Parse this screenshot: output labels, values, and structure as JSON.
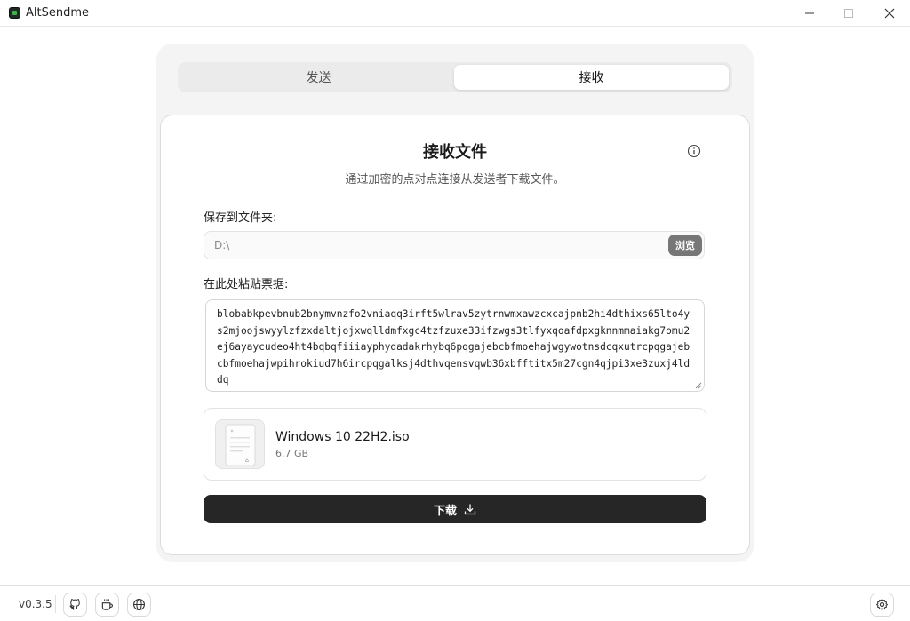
{
  "window": {
    "title": "AltSendme",
    "controls": {
      "minimize": "minimize-icon",
      "maximize": "maximize-icon",
      "close": "close-icon"
    }
  },
  "tabs": [
    {
      "label": "发送",
      "active": false
    },
    {
      "label": "接收",
      "active": true
    }
  ],
  "receive": {
    "title": "接收文件",
    "subtitle": "通过加密的点对点连接从发送者下载文件。",
    "folder_label": "保存到文件夹:",
    "folder_value": "D:\\",
    "browse_label": "浏览",
    "ticket_label": "在此处粘贴票据:",
    "ticket_value": "blobabkpevbnub2bnymvnzfo2vniaqq3irft5wlrav5zytrnwmxawzcxcajpnb2hi4dthixs65lto4ys2mjoojswyylzfzxdaltjojxwqlldmfxgc4tzfzuxe33ifzwgs3tlfyxqoafdpxgknnmmaiakg7omu2ej6ayaycudeo4ht4bqbqfiiiayphydadakrhybq6pqgajebcbfmoehajwgywotnsdcqxutrcpqgajebcbfmoehajwpihrokiud7h6ircpqgalksj4dthvqensvqwb36xbfftitx5m27cgn4qjpi3xe3zuxj4lddq",
    "file": {
      "name": "Windows 10 22H2.iso",
      "size": "6.7 GB"
    },
    "download_label": "下载"
  },
  "footer": {
    "version": "v0.3.5",
    "icons": [
      "github-icon",
      "coffee-icon",
      "globe-icon",
      "settings-icon"
    ]
  },
  "colors": {
    "accent_dark": "#262626",
    "browse_button": "#777777",
    "app_icon_green": "#3cb04c"
  }
}
